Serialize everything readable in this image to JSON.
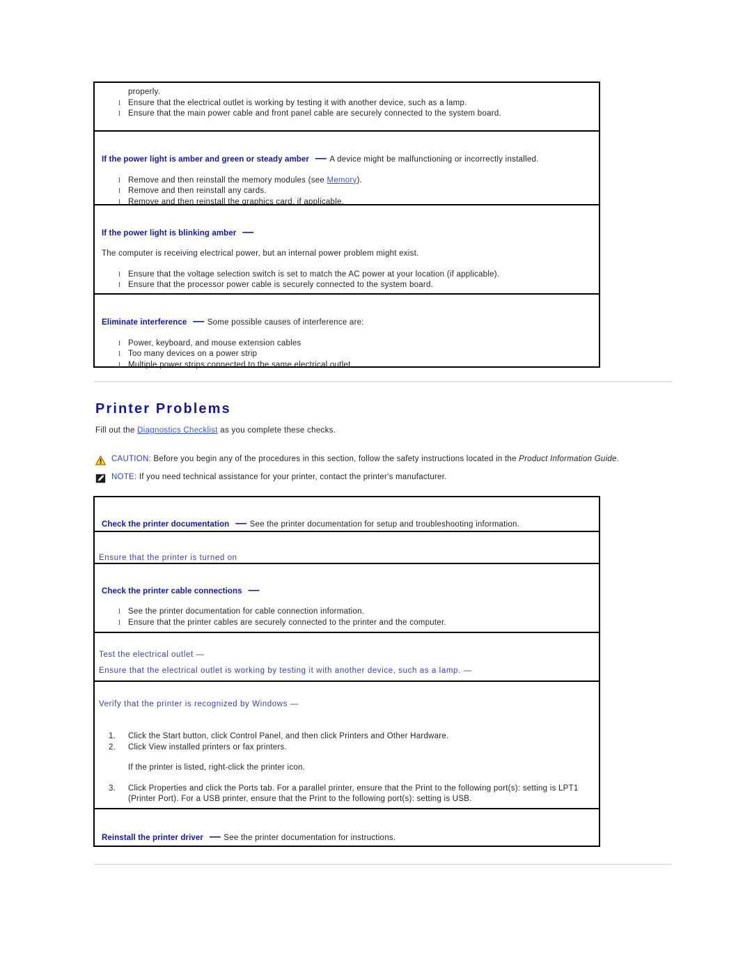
{
  "colors": {
    "heading_blue": "#12199b",
    "link_blue": "#3d58c8",
    "plain_blue": "#3a3fa0",
    "body_black": "#231f20",
    "rule_gray": "#e2e2e2",
    "caution_yellow": "#ffd400"
  },
  "power_table": {
    "rows": [
      {
        "id": "continued-row",
        "lead_text": "properly.",
        "bullets": [
          "Ensure that the electrical outlet is working by testing it with another device, such as a lamp.",
          "Ensure that the main power cable and front panel cable are securely connected to the system board."
        ]
      },
      {
        "id": "amber-green-steady-amber",
        "title": "If the power light is amber and green or steady amber",
        "dash": "—",
        "title_rest": "A device might be malfunctioning or incorrectly installed.",
        "bullets_prefix": "Remove and then reinstall the memory modules (see ",
        "bullets_link": "Memory",
        "bullets_suffix": ").",
        "bullets": [
          "Remove and then reinstall any cards.",
          "Remove and then reinstall the graphics card, if applicable."
        ]
      },
      {
        "id": "blinking-amber",
        "title": "If the power light is blinking amber",
        "dash": "—",
        "body": "The computer is receiving electrical power, but an internal power problem might exist.",
        "bullets": [
          "Ensure that the voltage selection switch is set to match the AC power at your location (if applicable).",
          "Ensure that the processor power cable is securely connected to the system board."
        ]
      },
      {
        "id": "eliminate-interference",
        "title": "Eliminate interference",
        "dash": "—",
        "title_rest": "Some possible causes of interference are:",
        "bullets": [
          "Power, keyboard, and mouse extension cables",
          "Too many devices on a power strip",
          "Multiple power strips connected to the same electrical outlet"
        ]
      }
    ]
  },
  "section": {
    "heading": "Printer Problems",
    "intro_before": "Fill out the ",
    "intro_link": "Diagnostics Checklist",
    "intro_after": " as you complete these checks.",
    "caution": {
      "icon": "warning-triangle-icon",
      "label": "CAUTION:",
      "text_before": " Before you begin any of the procedures in this section, follow the safety instructions located in the ",
      "text_italic": "Product Information Guide",
      "text_after": "."
    },
    "note": {
      "icon": "note-pencil-icon",
      "label": "NOTE:",
      "text": " If you need technical assistance for your printer, contact the printer's manufacturer."
    }
  },
  "printer_table": {
    "rows": [
      {
        "id": "check-printer-documentation",
        "title": "Check the printer documentation",
        "dash": "—",
        "title_rest": "See the printer documentation for setup and troubleshooting information."
      },
      {
        "id": "printer-turned-on",
        "plain_title": "Ensure that the printer is turned on"
      },
      {
        "id": "check-printer-cable-connections",
        "title": "Check the printer cable connections",
        "dash": "—",
        "bullets": [
          "See the printer documentation for cable connection information.",
          "Ensure that the printer cables are securely connected to the printer and the computer."
        ]
      },
      {
        "id": "test-electrical-outlet",
        "plain_title": "Test the electrical outlet —",
        "plain_body": "Ensure that the electrical outlet is working by testing it with another device, such as a lamp. —"
      },
      {
        "id": "verify-printer-recognized",
        "plain_title": "Verify that the printer is recognized by Windows —",
        "steps": [
          "Click the Start button, click Control Panel, and then click Printers and Other Hardware.",
          "Click View installed printers or fax printers."
        ],
        "interstitial": "If the printer is listed, right-click the printer icon.",
        "final_step": "Click Properties and click the Ports tab. For a parallel printer, ensure that the Print to the following port(s): setting is LPT1 (Printer Port). For a USB printer, ensure that the Print to the following port(s): setting is USB."
      },
      {
        "id": "reinstall-printer-driver",
        "title": "Reinstall the printer driver",
        "dash": "—",
        "title_rest": "See the printer documentation for instructions."
      }
    ]
  }
}
